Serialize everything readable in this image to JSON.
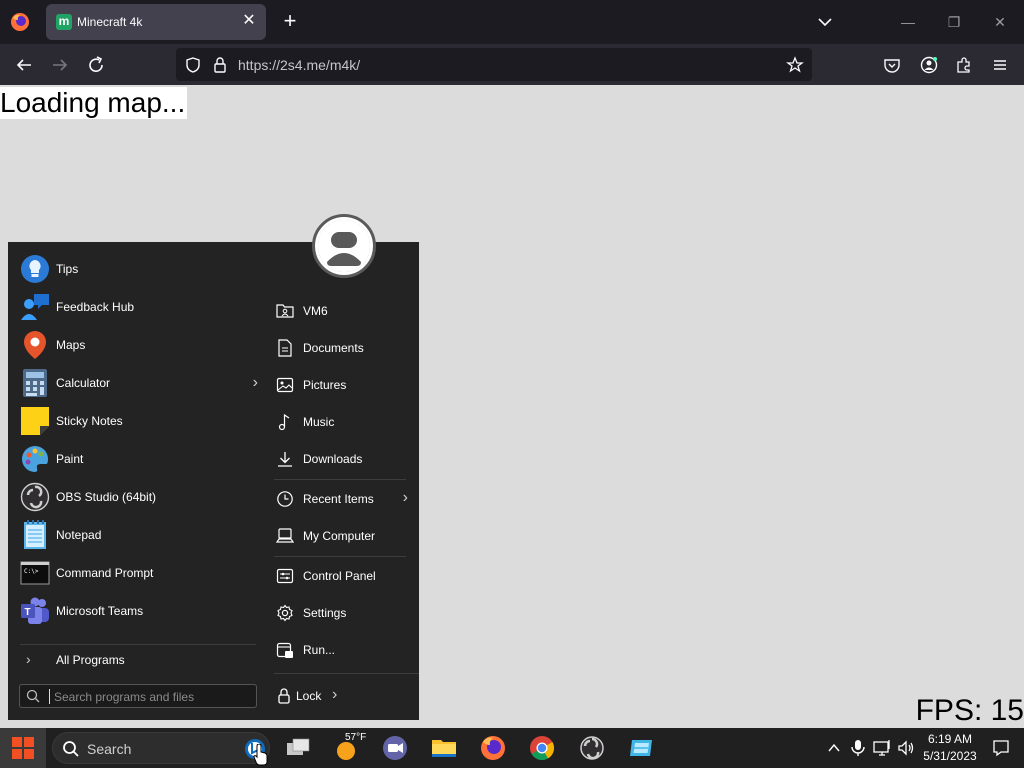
{
  "browser": {
    "tab_title": "Minecraft 4k",
    "tab_favicon_letter": "m",
    "url": "https://2s4.me/m4k/",
    "icons": [
      "firefox-icon",
      "back-icon",
      "forward-icon",
      "reload-icon",
      "shield-icon",
      "lock-icon",
      "bookmark-star-icon",
      "pocket-icon",
      "account-icon",
      "extensions-icon",
      "menu-icon"
    ]
  },
  "page": {
    "loading_text": "Loading map...",
    "fps_text": "FPS: 15"
  },
  "start_menu": {
    "programs": [
      {
        "label": "Tips",
        "icon": "lightbulb-icon",
        "has_submenu": false
      },
      {
        "label": "Feedback Hub",
        "icon": "feedback-icon",
        "has_submenu": false
      },
      {
        "label": "Maps",
        "icon": "map-pin-icon",
        "has_submenu": false
      },
      {
        "label": "Calculator",
        "icon": "calculator-icon",
        "has_submenu": true
      },
      {
        "label": "Sticky Notes",
        "icon": "sticky-notes-icon",
        "has_submenu": false
      },
      {
        "label": "Paint",
        "icon": "palette-icon",
        "has_submenu": false
      },
      {
        "label": "OBS Studio (64bit)",
        "icon": "obs-icon",
        "has_submenu": false
      },
      {
        "label": "Notepad",
        "icon": "notepad-icon",
        "has_submenu": false
      },
      {
        "label": "Command Prompt",
        "icon": "terminal-icon",
        "has_submenu": false
      },
      {
        "label": "Microsoft Teams",
        "icon": "teams-icon",
        "has_submenu": false
      }
    ],
    "all_programs_label": "All Programs",
    "search_placeholder": "Search programs and files",
    "places": [
      {
        "label": "VM6",
        "icon": "user-folder-icon"
      },
      {
        "label": "Documents",
        "icon": "document-icon"
      },
      {
        "label": "Pictures",
        "icon": "picture-icon"
      },
      {
        "label": "Music",
        "icon": "music-note-icon"
      },
      {
        "label": "Downloads",
        "icon": "download-icon"
      },
      {
        "label": "Recent Items",
        "icon": "clock-icon",
        "has_submenu": true
      },
      {
        "label": "My Computer",
        "icon": "computer-icon"
      },
      {
        "label": "Control Panel",
        "icon": "control-panel-icon"
      },
      {
        "label": "Settings",
        "icon": "gear-icon"
      },
      {
        "label": "Run...",
        "icon": "run-icon"
      }
    ],
    "lock_label": "Lock"
  },
  "taskbar": {
    "search_label": "Search",
    "weather": "57°F",
    "time": "6:19 AM",
    "date": "5/31/2023"
  },
  "colors": {
    "tabbar_bg": "#1c1b22",
    "navbar_bg": "#2b2a33",
    "page_bg": "#dcdcdc",
    "menu_bg": "#232323",
    "taskbar_bg": "#202020"
  }
}
